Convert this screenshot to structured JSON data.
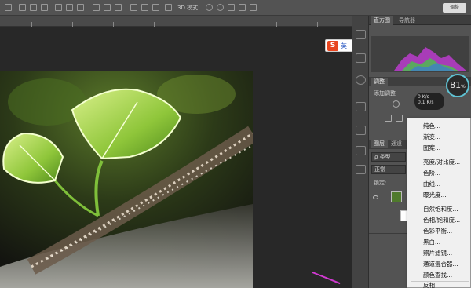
{
  "toolbar": {
    "mode_3d": "3D 模式:",
    "window_button": "调整"
  },
  "panels": {
    "histogram_tab": "直方图",
    "navigator_tab": "导航器",
    "adjustments_tab": "调整",
    "add_adjustment": "添加调整",
    "layers_tab": "图层",
    "channels_tab": "通道",
    "filter_kind": "类型",
    "blend_mode": "正常",
    "lock_label": "锁定:"
  },
  "ime": {
    "text": "英"
  },
  "gauge": {
    "value": "81",
    "unit": "%"
  },
  "net": {
    "up": "0 K/s",
    "down": "0.1 K/s"
  },
  "menu": {
    "items": [
      "纯色...",
      "渐变...",
      "图案...",
      "亮度/对比度...",
      "色阶...",
      "曲线...",
      "曝光度...",
      "自然饱和度...",
      "色相/饱和度...",
      "色彩平衡...",
      "黑白...",
      "照片滤镜...",
      "通道混合器...",
      "颜色查找...",
      "反相"
    ]
  },
  "colors": {
    "accent": "#e8461f",
    "gauge": "#5fc2d3",
    "cursor": "#d13ad1"
  }
}
